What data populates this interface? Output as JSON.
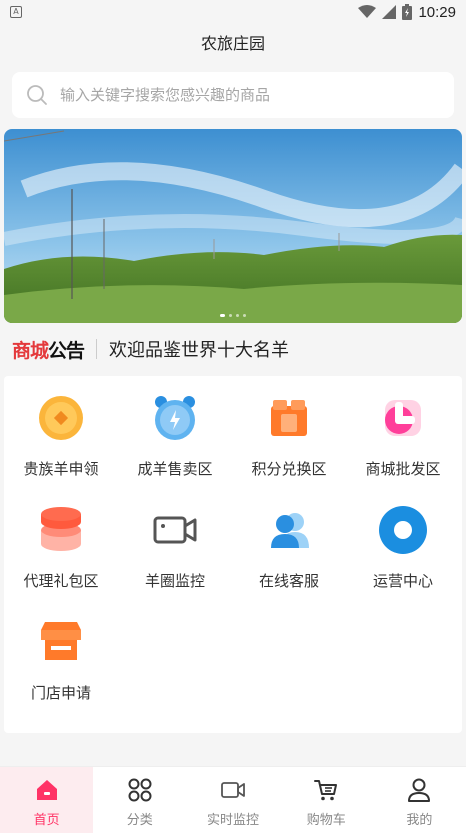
{
  "status_bar": {
    "notification_icon": "A",
    "time": "10:29",
    "icons": [
      "wifi-icon",
      "signal-icon",
      "battery-icon"
    ]
  },
  "header": {
    "title": "农旅庄园"
  },
  "search": {
    "placeholder": "输入关键字搜索您感兴趣的商品",
    "icon": "search-icon"
  },
  "banner": {
    "image": "grassy-hills-blue-sky",
    "dot_count": 4,
    "active_dot": 0
  },
  "notice": {
    "badge_part1": "商城",
    "badge_part2": "公告",
    "text": "欢迎品鉴世界十大名羊"
  },
  "grid": {
    "items": [
      {
        "label": "贵族羊申领",
        "icon": "gold-coin-icon"
      },
      {
        "label": "成羊售卖区",
        "icon": "alarm-clock-icon"
      },
      {
        "label": "积分兑换区",
        "icon": "gift-box-icon"
      },
      {
        "label": "商城批发区",
        "icon": "pink-l-icon"
      },
      {
        "label": "代理礼包区",
        "icon": "stack-icon"
      },
      {
        "label": "羊圈监控",
        "icon": "camera-icon"
      },
      {
        "label": "在线客服",
        "icon": "users-icon"
      },
      {
        "label": "运营中心",
        "icon": "target-icon"
      },
      {
        "label": "门店申请",
        "icon": "store-icon"
      }
    ]
  },
  "tabs": {
    "items": [
      {
        "label": "首页",
        "icon": "home-icon",
        "active": true
      },
      {
        "label": "分类",
        "icon": "grid-icon",
        "active": false
      },
      {
        "label": "实时监控",
        "icon": "video-icon",
        "active": false
      },
      {
        "label": "购物车",
        "icon": "cart-icon",
        "active": false
      },
      {
        "label": "我的",
        "icon": "profile-icon",
        "active": false
      }
    ]
  },
  "colors": {
    "accent": "#ff3366",
    "notice_red": "#e4393c",
    "orange": "#ff7a2a",
    "blue": "#2a8fe0"
  }
}
